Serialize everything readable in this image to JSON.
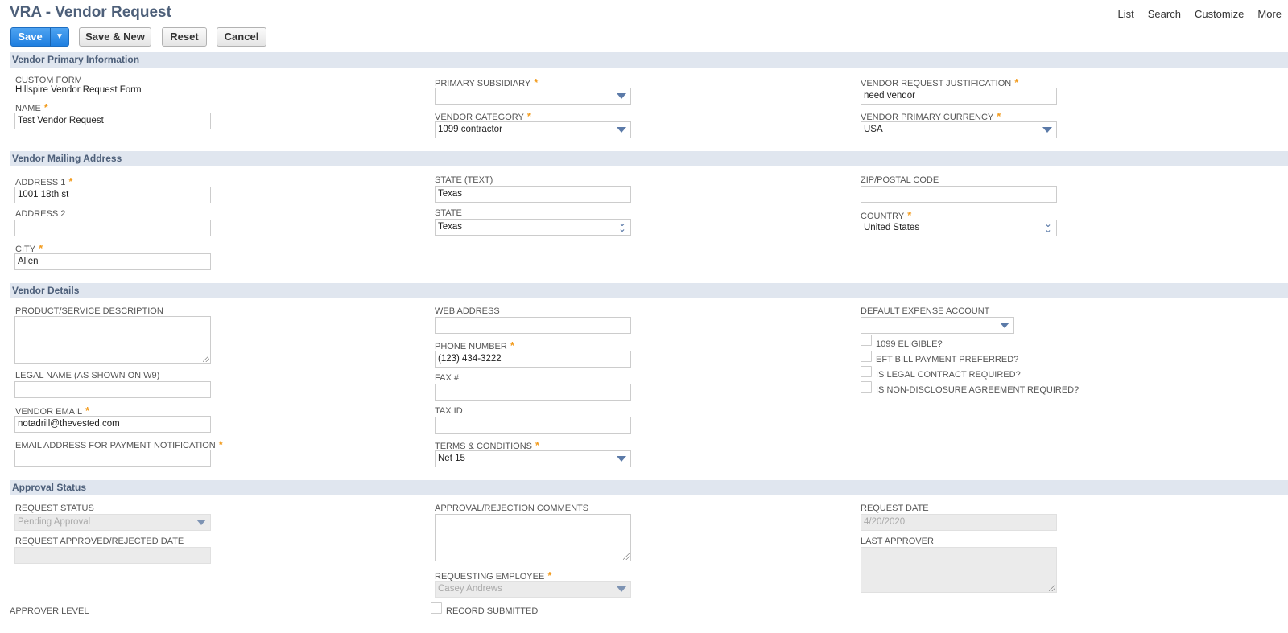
{
  "header": {
    "title": "VRA - Vendor Request",
    "links": [
      "List",
      "Search",
      "Customize",
      "More"
    ]
  },
  "toolbar": {
    "save": "Save",
    "save_arrow": "▼",
    "save_new": "Save & New",
    "reset": "Reset",
    "cancel": "Cancel"
  },
  "sections": {
    "primary": "Vendor Primary Information",
    "mailing": "Vendor Mailing Address",
    "details": "Vendor Details",
    "approval": "Approval Status"
  },
  "primary": {
    "custom_form_label": "CUSTOM FORM",
    "custom_form_value": "Hillspire Vendor Request Form",
    "name_label": "NAME",
    "name_value": "Test Vendor Request",
    "subsidiary_label": "PRIMARY SUBSIDIARY",
    "subsidiary_value": "",
    "category_label": "VENDOR CATEGORY",
    "category_value": "1099 contractor",
    "justification_label": "VENDOR REQUEST JUSTIFICATION",
    "justification_value": "need vendor",
    "currency_label": "VENDOR PRIMARY CURRENCY",
    "currency_value": "USA"
  },
  "mailing": {
    "address1_label": "ADDRESS 1",
    "address1_value": "1001 18th st",
    "address2_label": "ADDRESS 2",
    "address2_value": "",
    "city_label": "CITY",
    "city_value": "Allen",
    "state_text_label": "STATE (TEXT)",
    "state_text_value": "Texas",
    "state_label": "STATE",
    "state_value": "Texas",
    "zip_label": "ZIP/POSTAL CODE",
    "zip_value": "",
    "country_label": "COUNTRY",
    "country_value": "United States"
  },
  "details": {
    "product_desc_label": "PRODUCT/SERVICE DESCRIPTION",
    "legal_name_label": "LEGAL NAME (AS SHOWN ON W9)",
    "legal_name_value": "",
    "vendor_email_label": "VENDOR EMAIL",
    "vendor_email_value": "notadrill@thevested.com",
    "payment_email_label": "EMAIL ADDRESS FOR PAYMENT NOTIFICATION",
    "payment_email_value": "",
    "web_label": "WEB ADDRESS",
    "web_value": "",
    "phone_label": "PHONE NUMBER",
    "phone_value": "(123) 434-3222",
    "fax_label": "FAX #",
    "fax_value": "",
    "taxid_label": "TAX ID",
    "taxid_value": "",
    "terms_label": "TERMS & CONDITIONS",
    "terms_value": "Net 15",
    "expense_label": "DEFAULT EXPENSE ACCOUNT",
    "expense_value": "",
    "checkboxes": [
      "1099 ELIGIBLE?",
      "EFT BILL PAYMENT PREFERRED?",
      "IS LEGAL CONTRACT REQUIRED?",
      "IS NON-DISCLOSURE AGREEMENT REQUIRED?"
    ]
  },
  "approval": {
    "status_label": "REQUEST STATUS",
    "status_value": "Pending Approval",
    "approved_date_label": "REQUEST APPROVED/REJECTED DATE",
    "approved_date_value": "",
    "comments_label": "APPROVAL/REJECTION COMMENTS",
    "employee_label": "REQUESTING EMPLOYEE",
    "employee_value": "Casey Andrews",
    "request_date_label": "REQUEST DATE",
    "request_date_value": "4/20/2020",
    "last_approver_label": "LAST APPROVER",
    "approver_level_label": "APPROVER LEVEL",
    "record_submitted_label": "RECORD SUBMITTED"
  },
  "required_mark": "*",
  "colors": {
    "accent": "#1f7fe0",
    "section_bg": "#e0e6ef",
    "section_text": "#4d5f79",
    "required": "#f29c1f"
  }
}
